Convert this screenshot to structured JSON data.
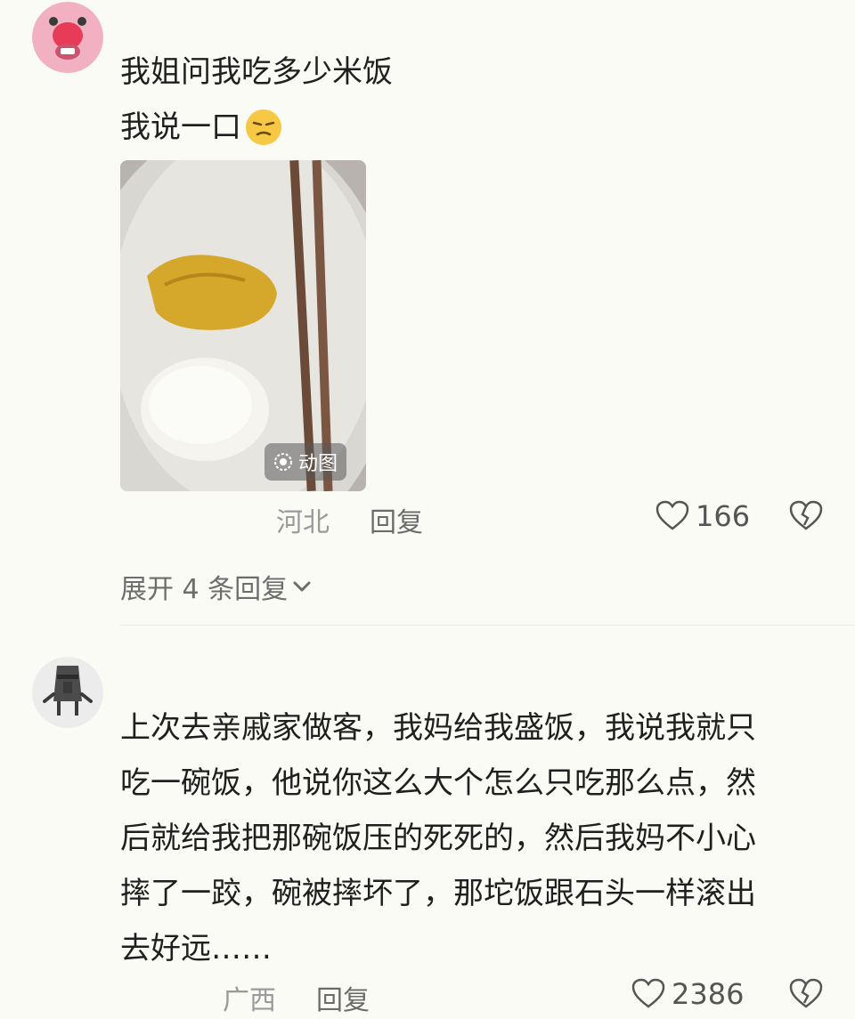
{
  "comments": [
    {
      "text_lines": [
        "我姐问我吃多少米饭",
        "我说一口"
      ],
      "gif_label": "动图",
      "location": "河北",
      "reply_label": "回复",
      "likes": "166",
      "expand_label": "展开 4 条回复"
    },
    {
      "text_lines": [
        "上次去亲戚家做客，我妈给我盛饭，我说我就只",
        "吃一碗饭，他说你这么大个怎么只吃那么点，然",
        "后就给我把那碗饭压的死死的，然后我妈不小心",
        "摔了一跤，碗被摔坏了，那坨饭跟石头一样滚出",
        "去好远……"
      ],
      "location": "广西",
      "reply_label": "回复",
      "likes": "2386"
    }
  ]
}
